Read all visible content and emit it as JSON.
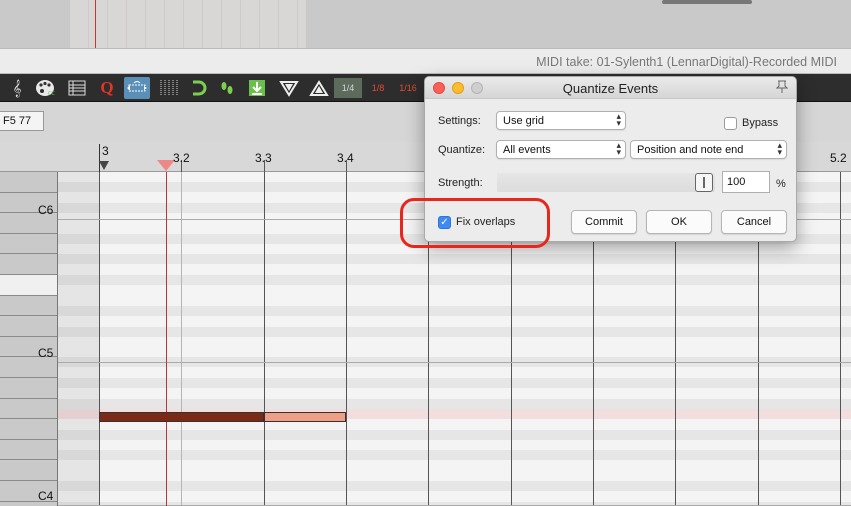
{
  "window": {
    "title": "MIDI take: 01-Sylenth1 (LennarDigital)-Recorded MIDI"
  },
  "toolbar": {
    "grid_options": [
      "1/4",
      "1/8",
      "1/16"
    ],
    "active_grid": "1/4",
    "icons": [
      "treble-clef-icon",
      "palette-icon",
      "list-icon",
      "quantize-q-icon",
      "swing-icon",
      "grid-lines-icon",
      "loop-magnet-icon",
      "footprints-icon",
      "insert-down-icon",
      "triangle-down-icon",
      "triangle-up-icon"
    ],
    "quantize_glyph": "Q"
  },
  "info": {
    "note_field": "F5 77"
  },
  "ruler": {
    "labels": [
      "3",
      "3.2",
      "3.3",
      "3.4",
      "5.2"
    ]
  },
  "keys": {
    "labels": [
      "C6",
      "C5",
      "C4"
    ]
  },
  "dialog": {
    "title": "Quantize Events",
    "settings_label": "Settings:",
    "settings_value": "Use grid",
    "bypass_label": "Bypass",
    "bypass_checked": false,
    "quantize_label": "Quantize:",
    "quantize_value": "All events",
    "position_value": "Position and note end",
    "strength_label": "Strength:",
    "strength_value": "100",
    "strength_unit": "%",
    "fix_overlaps_label": "Fix overlaps",
    "fix_overlaps_checked": true,
    "commit_label": "Commit",
    "ok_label": "OK",
    "cancel_label": "Cancel"
  },
  "colors": {
    "annotation_ring": "#e8261b",
    "note_dark": "#7c2a16",
    "note_light": "#ef9f87",
    "checkbox_blue": "#3d8bf2"
  }
}
